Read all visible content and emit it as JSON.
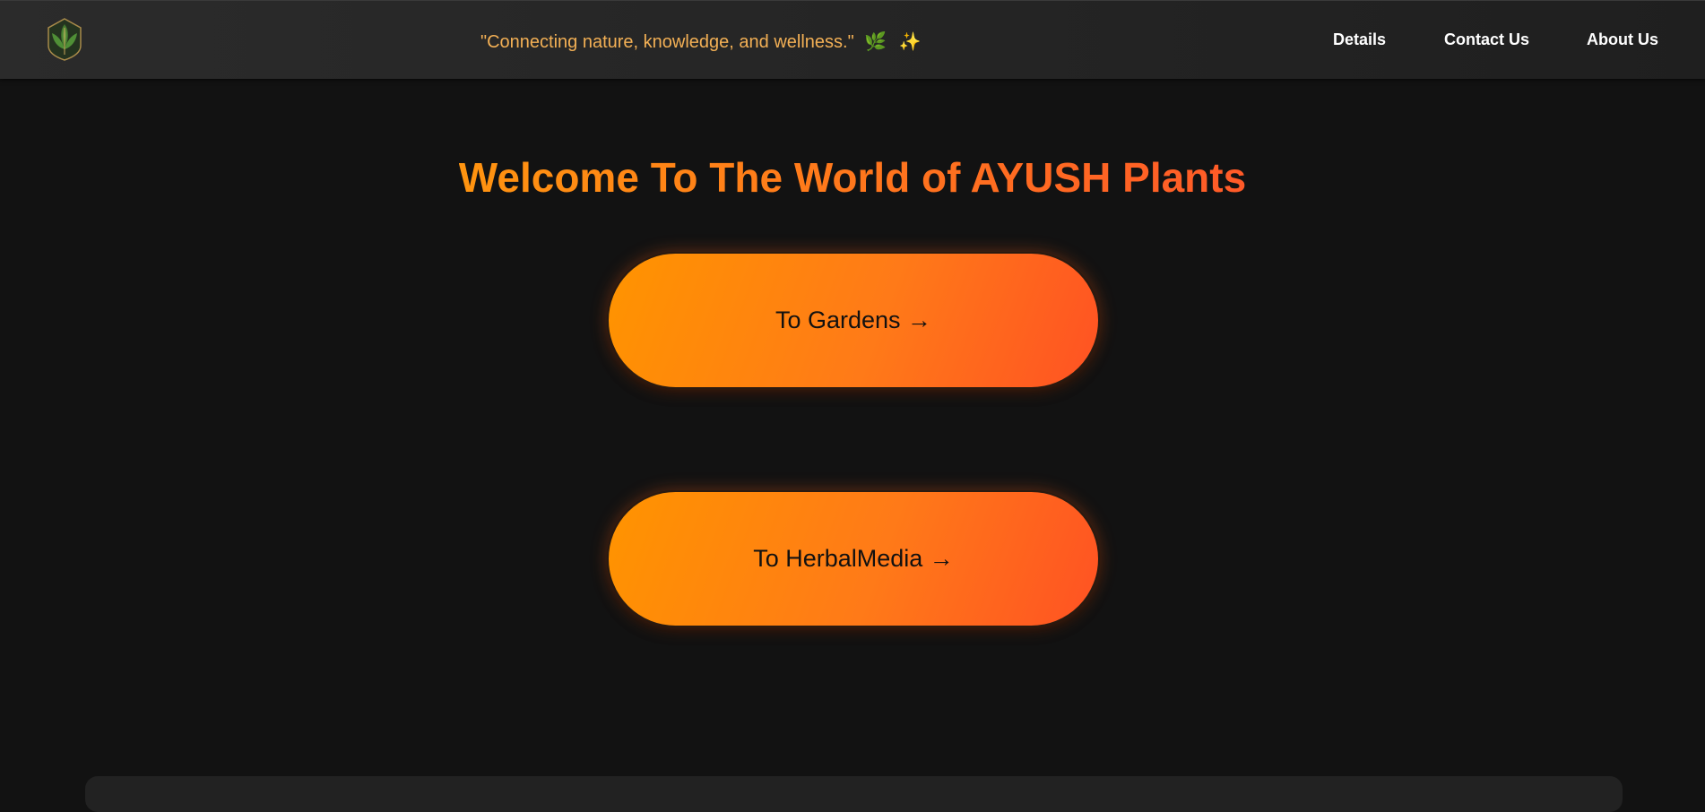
{
  "header": {
    "logo_icon": "leaf-icon",
    "tagline": "\"Connecting nature, knowledge, and wellness.\"",
    "tagline_emoji_leaf": "🌿",
    "tagline_emoji_spark": "✨",
    "nav": {
      "details": "Details",
      "contact": "Contact Us",
      "about": "About Us"
    }
  },
  "main": {
    "title": "Welcome To The World of AYUSH Plants",
    "buttons": {
      "gardens": "To Gardens →",
      "herbal": "To HerbalMedia →"
    }
  },
  "colors": {
    "background": "#121212",
    "accent_start": "#ff9400",
    "accent_end": "#ff5223",
    "tagline": "#f3b055"
  }
}
